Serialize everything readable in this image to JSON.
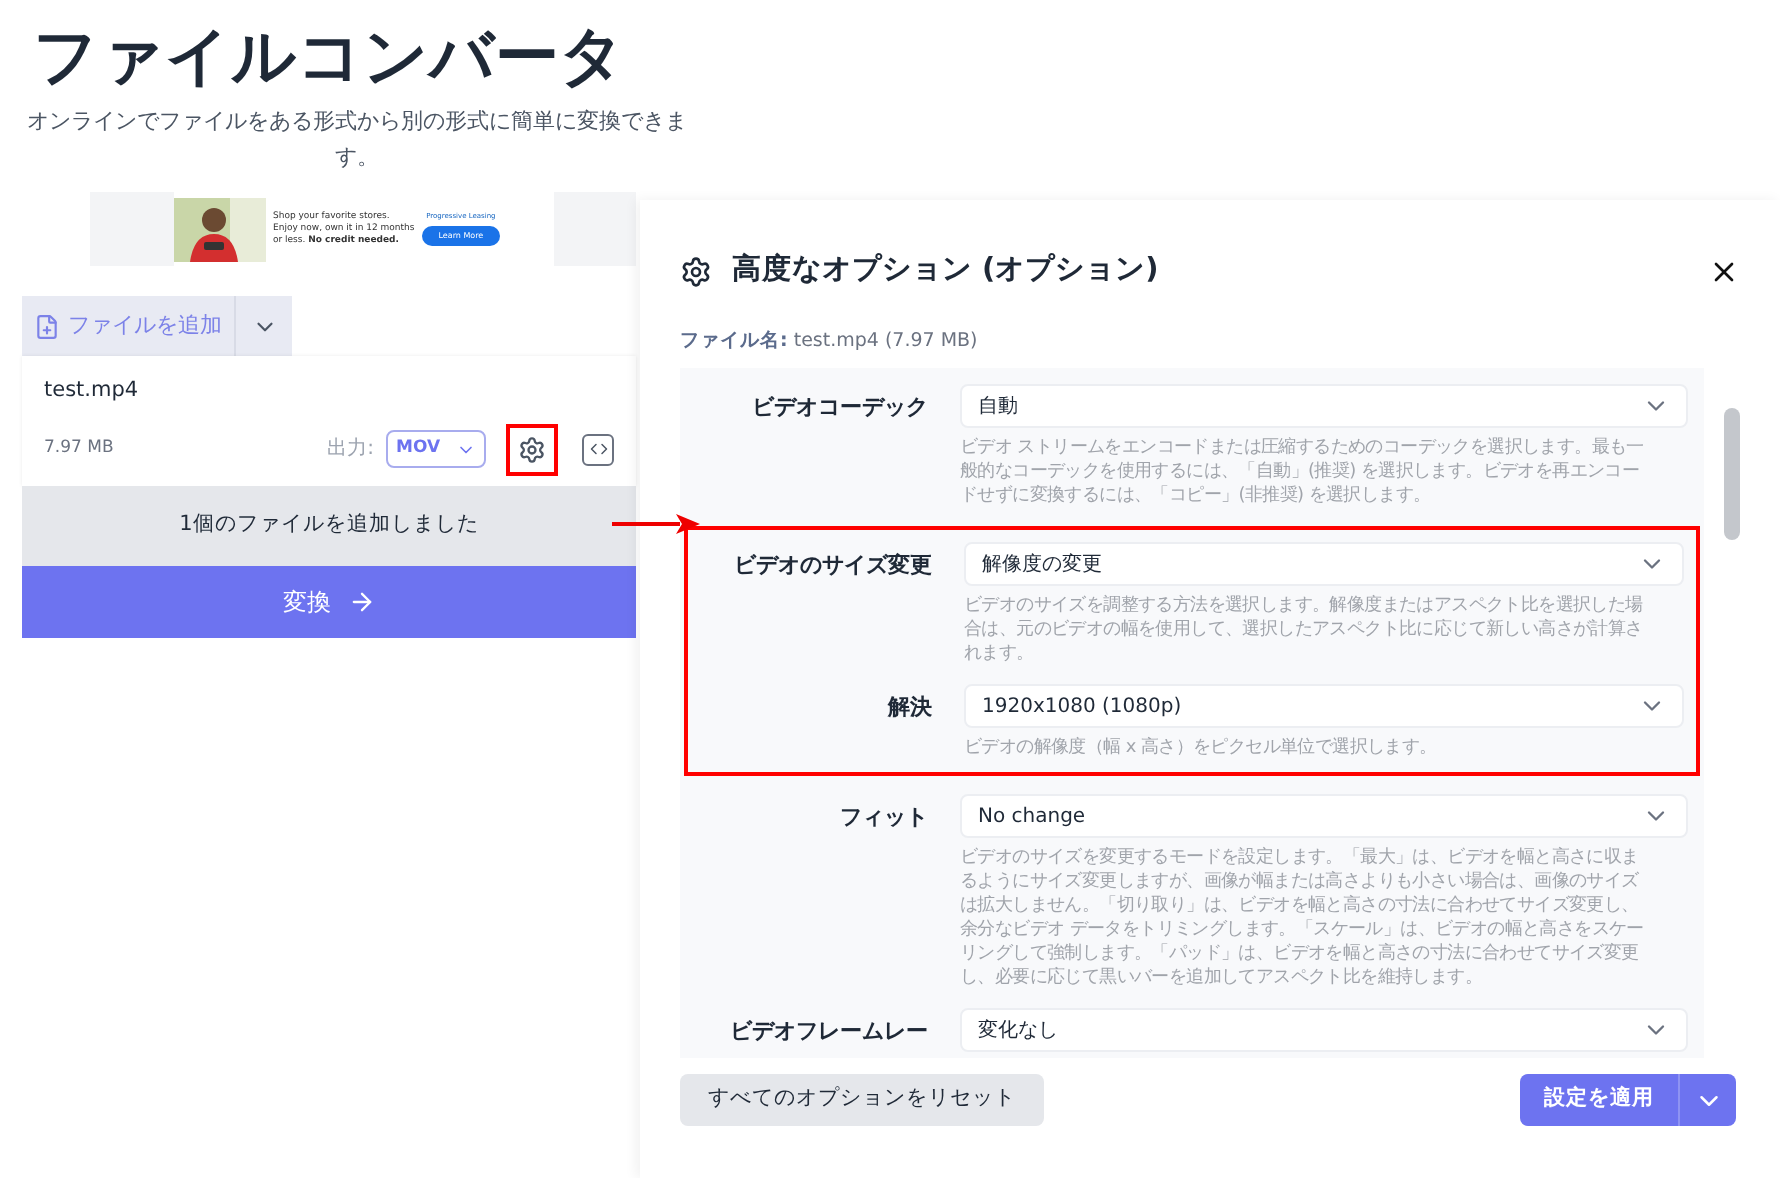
{
  "header": {
    "title": "ファイルコンバータ",
    "subtitle": "オンラインでファイルをある形式から別の形式に簡単に変換できます。"
  },
  "ad": {
    "kind": "picture",
    "text_lines": [
      "Shop your favorite stores.",
      "Enjoy now, own it in 12 months",
      "or less. **No credit needed.**"
    ],
    "brand": "Progressive Leasing",
    "button": "Learn More"
  },
  "converter": {
    "add_button": "ファイルを追加",
    "file": {
      "name": "test.mp4",
      "size": "7.97 MB",
      "output_label": "出力:",
      "output_format": "MOV",
      "settings_highlighted": true
    },
    "status": "1個のファイルを追加しました",
    "convert_button": "変換"
  },
  "dialog": {
    "title": "高度なオプション (オプション)",
    "file_label": "ファイル名:",
    "file_value": "test.mp4 (7.97 MB)",
    "options": [
      {
        "label": "ビデオコーデック",
        "value": "自動",
        "description": "ビデオ ストリームをエンコードまたは圧縮するためのコーデックを選択します。最も一般的なコーデックを使用するには、「自動」(推奨) を選択します。ビデオを再エンコードせずに変換するには、「コピー」(非推奨) を選択します。",
        "highlighted": false
      },
      {
        "label": "ビデオのサイズ変更",
        "value": "解像度の変更",
        "description": "ビデオのサイズを調整する方法を選択します。解像度またはアスペクト比を選択した場合は、元のビデオの幅を使用して、選択したアスペクト比に応じて新しい高さが計算されます。",
        "highlighted": true
      },
      {
        "label": "解決",
        "value": "1920x1080 (1080p)",
        "description": "ビデオの解像度（幅 x 高さ）をピクセル単位で選択します。",
        "highlighted": true
      },
      {
        "label": "フィット",
        "value": "No change",
        "description": "ビデオのサイズを変更するモードを設定します。「最大」は、ビデオを幅と高さに収まるようにサイズ変更しますが、画像が幅または高さよりも小さい場合は、画像のサイズは拡大しません。「切り取り」は、ビデオを幅と高さの寸法に合わせてサイズ変更し、余分なビデオ データをトリミングします。「スケール」は、ビデオの幅と高さをスケーリングして強制します。「パッド」は、ビデオを幅と高さの寸法に合わせてサイズ変更し、必要に応じて黒いバーを追加してアスペクト比を維持します。",
        "highlighted": false
      },
      {
        "label": "ビデオフレームレー",
        "value": "変化なし",
        "highlighted": false
      }
    ],
    "reset_button": "すべてのオプションをリセット",
    "apply_button": "設定を適用"
  }
}
